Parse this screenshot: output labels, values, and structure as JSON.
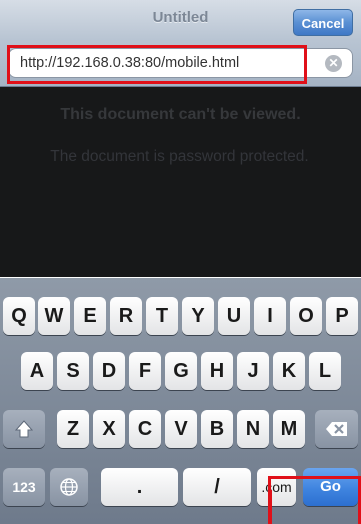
{
  "navbar": {
    "title": "Untitled",
    "cancel_label": "Cancel",
    "url_value": "http://192.168.0.38:80/mobile.html"
  },
  "content": {
    "message_title": "This document can't be viewed.",
    "message_body": "The document is password protected."
  },
  "keyboard": {
    "row1": [
      "Q",
      "W",
      "E",
      "R",
      "T",
      "Y",
      "U",
      "I",
      "O",
      "P"
    ],
    "row2": [
      "A",
      "S",
      "D",
      "F",
      "G",
      "H",
      "J",
      "K",
      "L"
    ],
    "row3": [
      "Z",
      "X",
      "C",
      "V",
      "B",
      "N",
      "M"
    ],
    "row4": {
      "numbers_label": "123",
      "dot_label": ".",
      "slash_label": "/",
      "com_label": ".com",
      "go_label": "Go"
    },
    "icons": {
      "shift": "shift-arrow-icon",
      "delete": "backspace-icon",
      "globe": "globe-icon",
      "clear": "clear-x-icon"
    }
  },
  "colors": {
    "highlight": "#e01019",
    "go_key": "#3f84df",
    "cancel_button": "#5a90d3"
  }
}
